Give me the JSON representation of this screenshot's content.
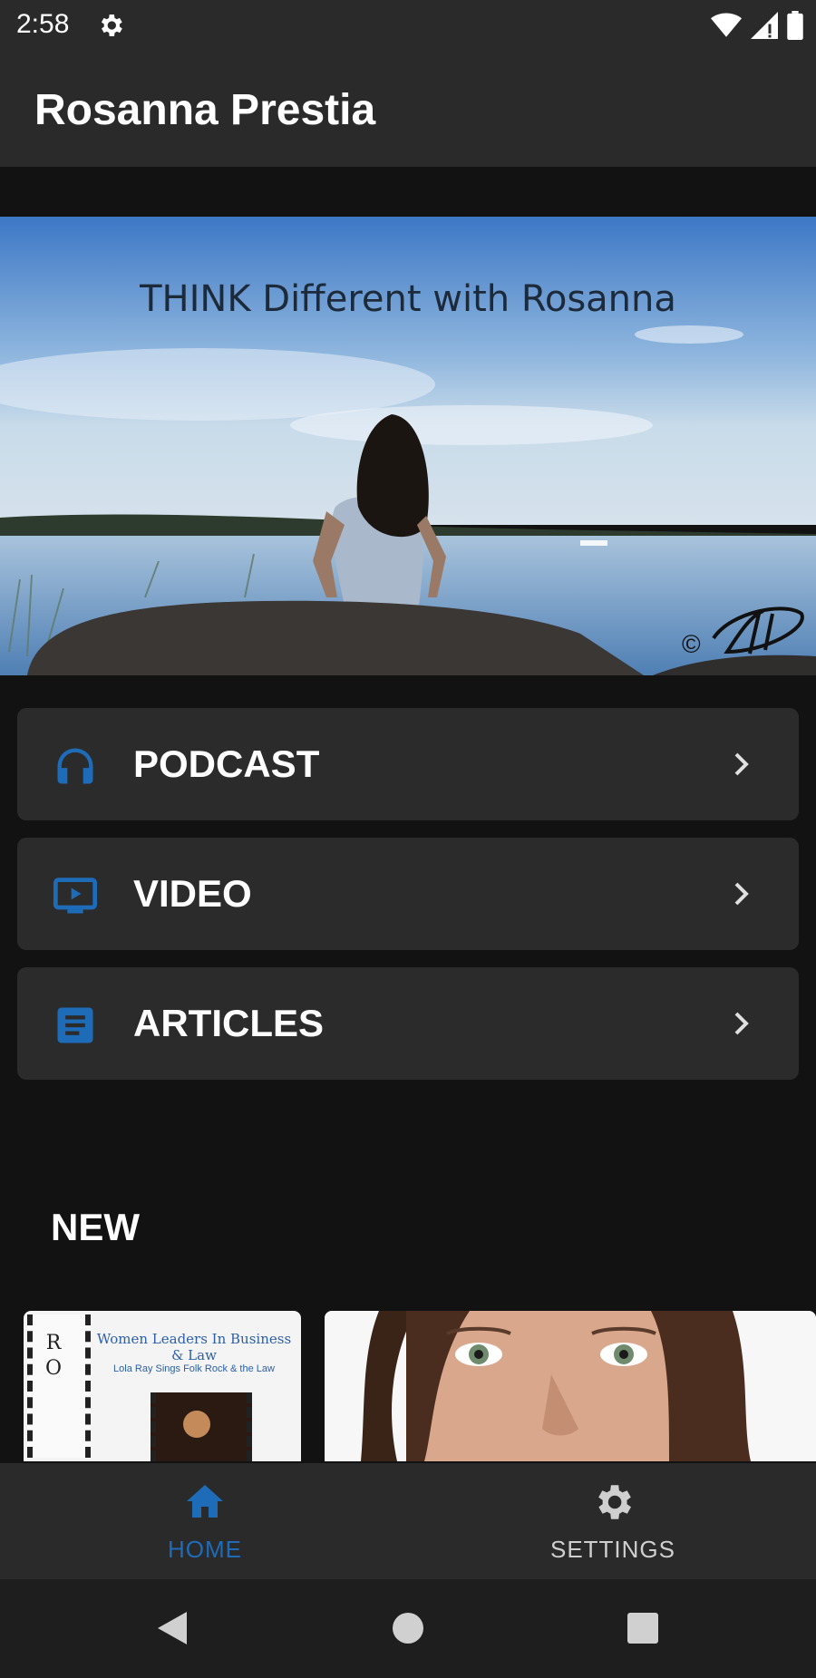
{
  "status_bar": {
    "time": "2:58",
    "icons": [
      "settings-icon",
      "wifi-icon",
      "signal-icon",
      "battery-icon"
    ]
  },
  "app_bar": {
    "title": "Rosanna Prestia"
  },
  "hero": {
    "caption": "THINK Different with Rosanna",
    "signature": "©"
  },
  "menu": {
    "items": [
      {
        "label": "PODCAST",
        "icon": "headphones-icon"
      },
      {
        "label": "VIDEO",
        "icon": "video-icon"
      },
      {
        "label": "ARTICLES",
        "icon": "article-icon"
      }
    ]
  },
  "new_section": {
    "title": "NEW",
    "items": [
      {
        "title": "Women Leaders In Business & Law",
        "subtitle": "Lola Ray Sings Folk Rock & the Law",
        "logo": "R O"
      },
      {
        "title": ""
      }
    ]
  },
  "bottom_nav": {
    "items": [
      {
        "label": "HOME",
        "icon": "home-icon",
        "active": true
      },
      {
        "label": "SETTINGS",
        "icon": "gear-icon",
        "active": false
      }
    ]
  },
  "colors": {
    "accent": "#1e6bb8",
    "background": "#121212",
    "surface": "#2b2b2b",
    "bar": "#2a2a2a",
    "inactive": "#cfcfcf"
  }
}
